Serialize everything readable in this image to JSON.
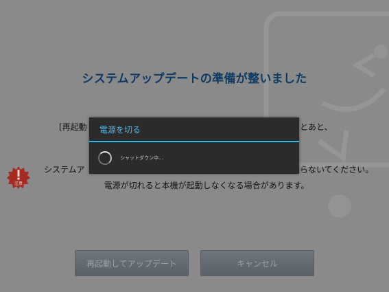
{
  "screen": {
    "title": "システムアップデートの準備が整いました",
    "instruction_left": "[再起動",
    "instruction_right": "とあと、",
    "warning_left": "システムア",
    "warning_right": "らないてください。",
    "warning_line2": "電源が切れると本機が起動しなくなる場合があります。",
    "warning_badge_icon": "exclamation-badge-icon",
    "warning_badge_label": "注意"
  },
  "buttons": {
    "update_label": "再起動してアップデート",
    "cancel_label": "キャンセル"
  },
  "dialog": {
    "title": "電源を切る",
    "message": "シャットダウン中...",
    "spinner_icon": "loading-spinner-icon"
  },
  "colors": {
    "overlay": "#8a8a8a",
    "title_text": "#0e3a63",
    "dialog_bg": "#2b2b2b",
    "dialog_accent": "#33b5e5",
    "warning_badge": "#a42a22"
  }
}
